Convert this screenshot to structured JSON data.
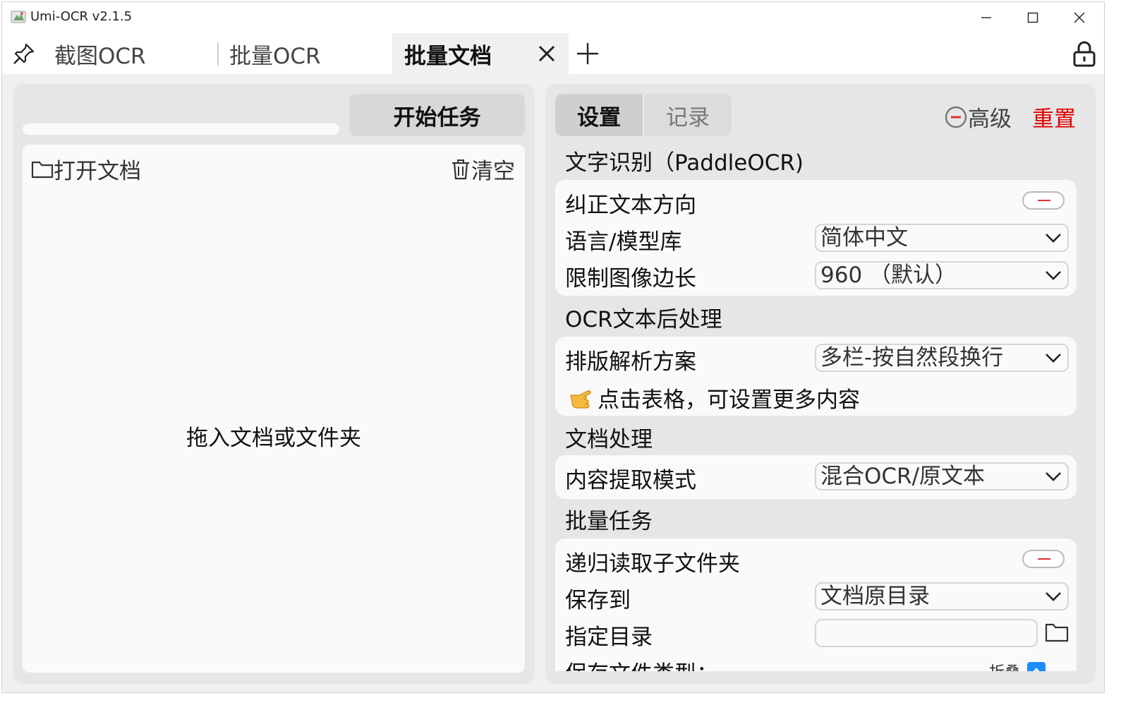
{
  "window": {
    "title": "Umi-OCR v2.1.5"
  },
  "tabs": [
    {
      "label": "截图OCR"
    },
    {
      "label": "批量OCR"
    },
    {
      "label": "批量文档"
    }
  ],
  "left": {
    "start_label": "开始任务",
    "open_label": "打开文档",
    "clear_label": "清空",
    "drop_hint": "拖入文档或文件夹"
  },
  "right": {
    "tab_settings": "设置",
    "tab_records": "记录",
    "advanced_label": "高级",
    "reset_label": "重置",
    "sections": {
      "ocr": {
        "title": "文字识别（PaddleOCR)",
        "correct_direction": "纠正文本方向",
        "language_label": "语言/模型库",
        "language_value": "简体中文",
        "limit_label": "限制图像边长",
        "limit_value": "960 （默认）"
      },
      "post": {
        "title": "OCR文本后处理",
        "layout_label": "排版解析方案",
        "layout_value": "多栏-按自然段换行",
        "tip": "点击表格，可设置更多内容"
      },
      "doc": {
        "title": "文档处理",
        "mode_label": "内容提取模式",
        "mode_value": "混合OCR/原文本"
      },
      "batch": {
        "title": "批量任务",
        "recursive_label": "递归读取子文件夹",
        "save_label": "保存到",
        "save_value": "文档原目录",
        "dir_label": "指定目录",
        "dir_value": "",
        "filetype_label": "保存文件类型：",
        "fold_label": "折叠"
      }
    }
  },
  "colors": {
    "accent_red": "#e00000",
    "toggle_off": "#e03030",
    "fold_blue": "#1a8cff"
  }
}
